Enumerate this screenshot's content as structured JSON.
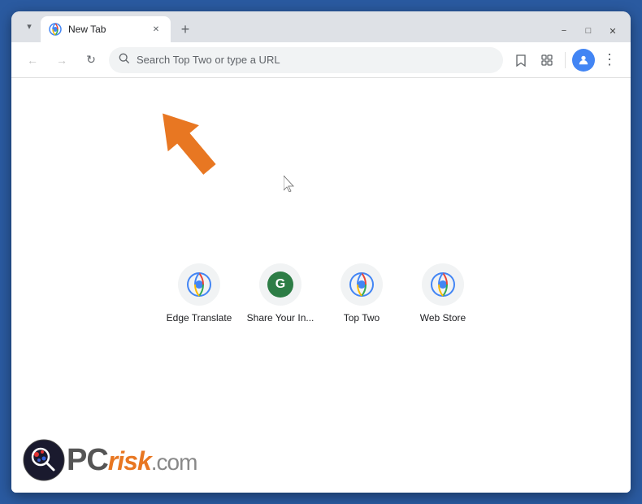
{
  "window": {
    "title": "New Tab",
    "controls": {
      "minimize": "−",
      "maximize": "□",
      "close": "✕"
    }
  },
  "tab": {
    "favicon": "🌐",
    "title": "New Tab",
    "close": "✕",
    "new_tab": "+"
  },
  "nav": {
    "back": "←",
    "forward": "→",
    "reload": "↻",
    "address_placeholder": "Search Top Two or type a URL",
    "search_icon": "🔍",
    "bookmark_icon": "☆",
    "extensions_icon": "⧉",
    "profile_icon": "👤",
    "menu_icon": "⋮"
  },
  "shortcuts": [
    {
      "label": "Edge Translate",
      "icon_type": "chrome",
      "icon_color": "#4285f4"
    },
    {
      "label": "Share Your In...",
      "icon_type": "letter",
      "icon_letter": "G",
      "icon_bg": "#2d7d46"
    },
    {
      "label": "Top Two",
      "icon_type": "chrome",
      "icon_color": "#4285f4"
    },
    {
      "label": "Web Store",
      "icon_type": "chrome",
      "icon_color": "#4285f4"
    }
  ],
  "watermark": {
    "pc_text": "PC",
    "risk_text": "risk",
    "domain": ".com"
  }
}
